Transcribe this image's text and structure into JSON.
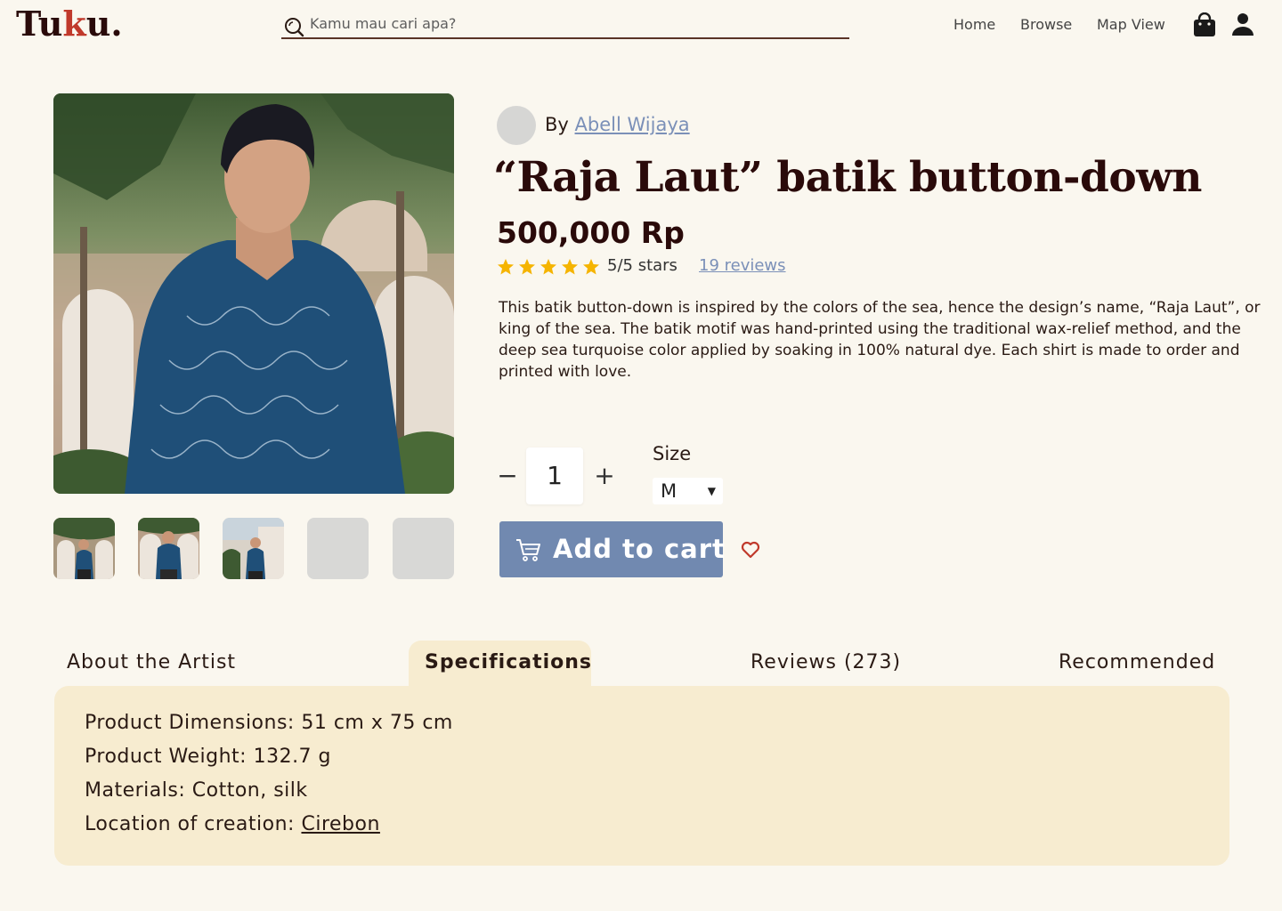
{
  "header": {
    "logo": {
      "part1": "Tu",
      "part2": "k",
      "part3": "u."
    },
    "search": {
      "placeholder": "Kamu mau cari apa?"
    },
    "nav": [
      "Home",
      "Browse",
      "Map View"
    ]
  },
  "product": {
    "artist": {
      "prefix": "By",
      "name": "Abell Wijaya"
    },
    "title": "“Raja Laut” batik button-down",
    "price": "500,000 Rp",
    "rating": {
      "stars": 5,
      "max": 5,
      "text": "5/5 stars",
      "reviews_link": "19 reviews"
    },
    "description": "This batik button-down is inspired by the colors of the sea, hence the design’s name, “Raja Laut”, or king of the sea. The batik motif was hand-printed using the traditional wax-relief method, and the deep sea turquoise color applied by soaking in 100% natural dye. Each shirt is made to order and printed with love.",
    "quantity": "1",
    "qty_minus": "−",
    "qty_plus": "+",
    "size_label": "Size",
    "size_value": "M",
    "add_to_cart": "Add to cart"
  },
  "tabs": [
    {
      "label": "About the Artist",
      "active": false
    },
    {
      "label": "Specifications",
      "active": true
    },
    {
      "label": "Reviews (273)",
      "active": false
    },
    {
      "label": "Recommended",
      "active": false
    }
  ],
  "specs": {
    "dimensions": "Product Dimensions: 51 cm x 75 cm",
    "weight": "Product Weight: 132.7 g",
    "materials": "Materials: Cotton, silk",
    "location_prefix": "Location of creation: ",
    "location_link": "Cirebon"
  },
  "colors": {
    "accent": "#7189b0",
    "background": "#faf7ef",
    "panel": "#f7ecd0",
    "star": "#f5b400",
    "heart": "#c0392b"
  }
}
